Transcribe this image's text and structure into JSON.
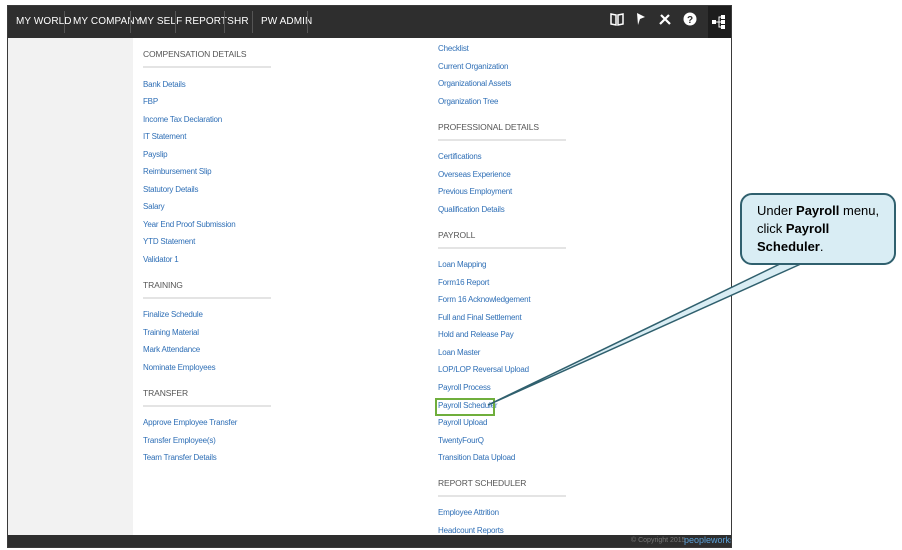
{
  "nav": {
    "items": [
      "MY WORLD",
      "MY COMPANY",
      "MY SELF",
      "REPORTS",
      "HR",
      "PW ADMIN"
    ]
  },
  "toolbar": {
    "icons": [
      "book-icon",
      "pin-icon",
      "tools-icon",
      "help-icon",
      "sitemap-icon"
    ]
  },
  "left_column": {
    "compensation": {
      "title": "COMPENSATION DETAILS",
      "links": [
        "Bank Details",
        "FBP",
        "Income Tax Declaration",
        "IT Statement",
        "Payslip",
        "Reimbursement Slip",
        "Statutory Details",
        "Salary",
        "Year End Proof Submission",
        "YTD Statement",
        "Validator 1"
      ]
    },
    "training": {
      "title": "TRAINING",
      "links": [
        "Finalize Schedule",
        "Training Material",
        "Mark Attendance",
        "Nominate Employees"
      ]
    },
    "transfer": {
      "title": "TRANSFER",
      "links": [
        "Approve Employee Transfer",
        "Transfer Employee(s)",
        "Team Transfer Details"
      ]
    }
  },
  "right_column": {
    "top_links": [
      "Checklist",
      "Current Organization",
      "Organizational Assets",
      "Organization Tree"
    ],
    "professional": {
      "title": "PROFESSIONAL DETAILS",
      "links": [
        "Certifications",
        "Overseas Experience",
        "Previous Employment",
        "Qualification Details"
      ]
    },
    "payroll": {
      "title": "PAYROLL",
      "links": [
        "Loan Mapping",
        "Form16 Report",
        "Form 16 Acknowledgement",
        "Full and Final Settlement",
        "Hold and Release Pay",
        "Loan Master",
        "LOP/LOP Reversal Upload",
        "Payroll Process",
        "Payroll Scheduler",
        "Payroll Upload",
        "TwentyFourQ",
        "Transition Data Upload"
      ]
    },
    "report_scheduler": {
      "title": "REPORT SCHEDULER",
      "links": [
        "Employee Attrition",
        "Headcount Reports"
      ]
    }
  },
  "footer": {
    "copyright": "© Copyright 2015",
    "brand": "peopleworks"
  },
  "callout": {
    "pre": "Under ",
    "menu": "Payroll",
    "mid": " menu, click ",
    "item": "Payroll Scheduler",
    "post": "."
  },
  "colors": {
    "topbar": "#2e2e2e",
    "link": "#2f6fb6",
    "highlight": "#6fae3c",
    "callout_fill": "#d9edf4",
    "callout_border": "#30606e"
  }
}
